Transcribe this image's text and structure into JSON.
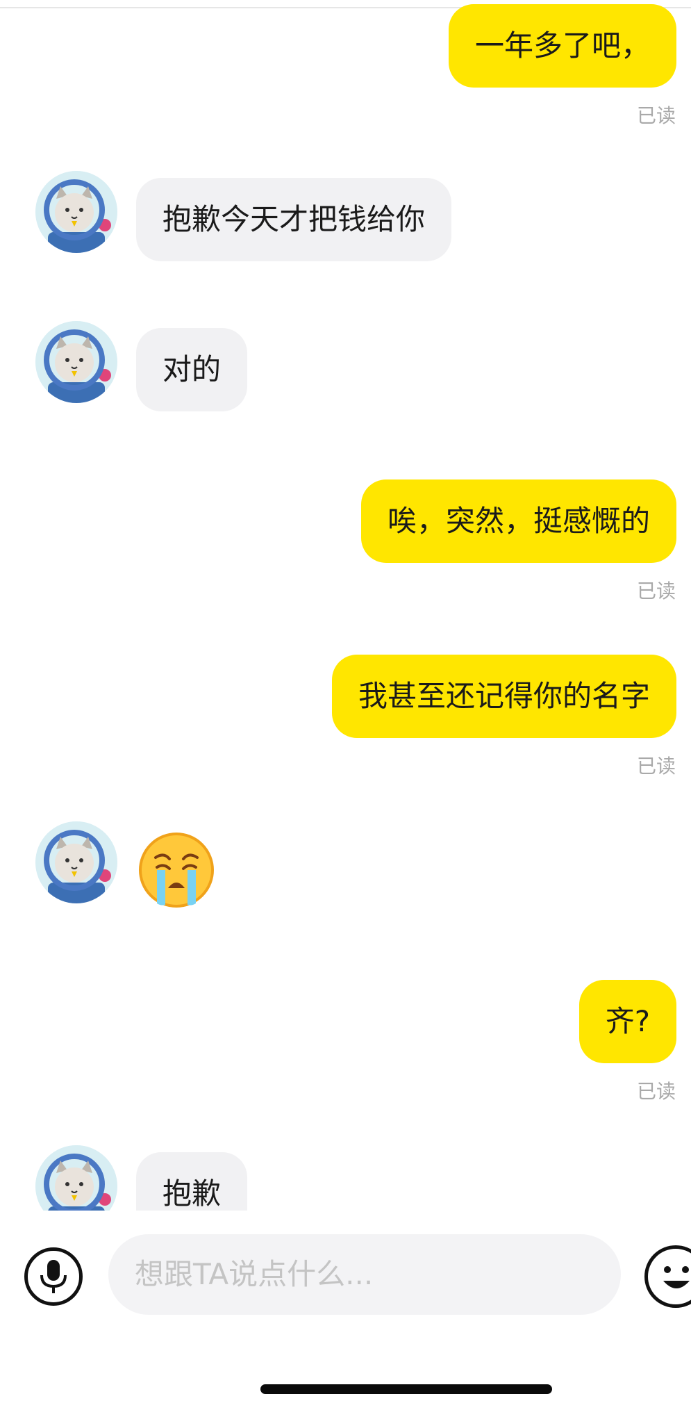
{
  "messages": [
    {
      "side": "out",
      "text": "一年多了吧，",
      "status": "已读"
    },
    {
      "side": "in",
      "text": "抱歉今天才把钱给你"
    },
    {
      "side": "in",
      "text": "对的"
    },
    {
      "side": "out",
      "text": "唉，突然，挺感慨的",
      "status": "已读"
    },
    {
      "side": "out",
      "text": "我甚至还记得你的名字",
      "status": "已读"
    },
    {
      "side": "in",
      "emoji": "loudly-crying-face"
    },
    {
      "side": "out",
      "text": "齐?",
      "status": "已读"
    },
    {
      "side": "in",
      "text": "抱歉"
    }
  ],
  "composer": {
    "placeholder": "想跟TA说点什么...",
    "left_icon": "microphone-icon",
    "right_icon": "smiley-icon"
  },
  "colors": {
    "outgoing_bubble": "#ffe600",
    "incoming_bubble": "#f1f1f3",
    "read_status": "#a9a9a9"
  }
}
